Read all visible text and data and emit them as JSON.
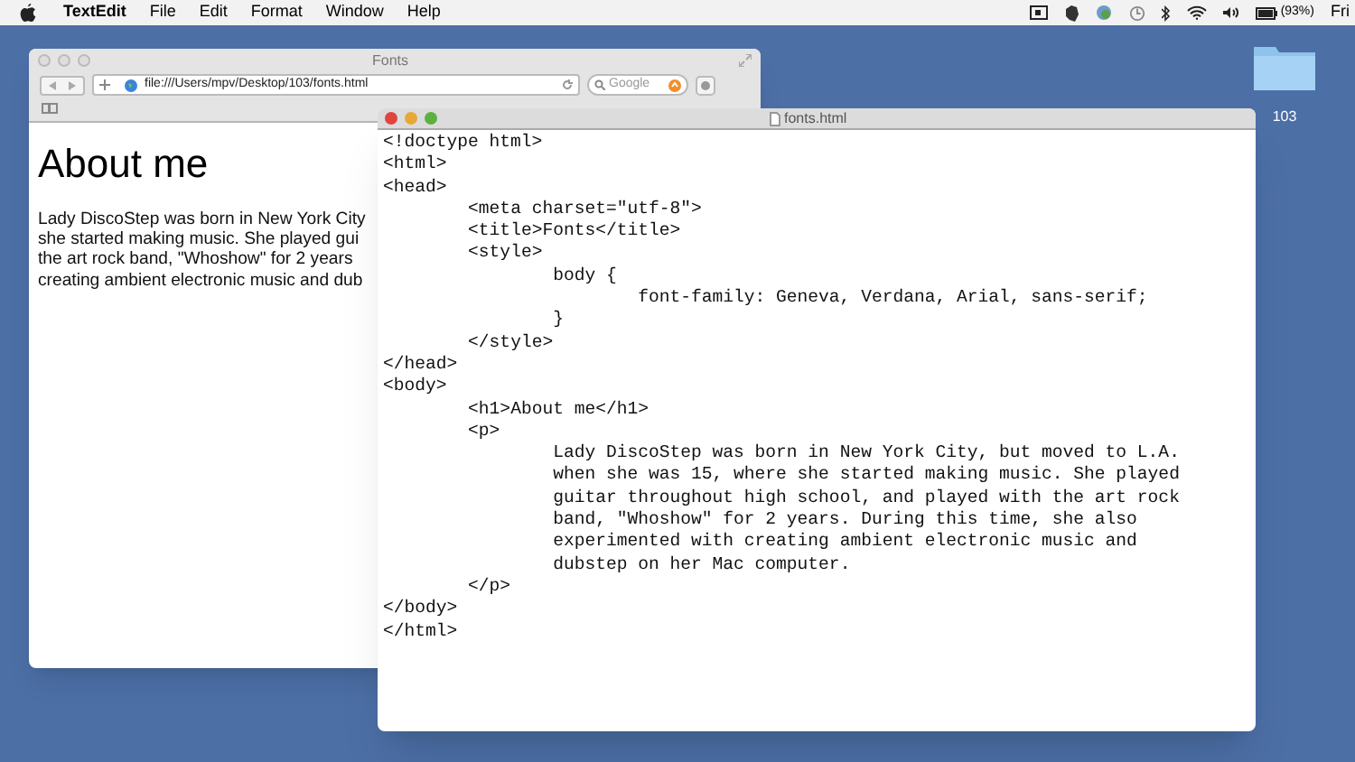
{
  "menu_bar": {
    "app": "TextEdit",
    "items": [
      "File",
      "Edit",
      "Format",
      "Window",
      "Help"
    ],
    "battery": "(93%)",
    "day": "Fri"
  },
  "desktop": {
    "folder_label": "103"
  },
  "browser": {
    "title": "Fonts",
    "address": "file:///Users/mpv/Desktop/103/fonts.html",
    "search_placeholder": "Google",
    "heading": "About me",
    "paragraph_lines": [
      "Lady DiscoStep was born in New York City",
      "she started making music. She played gui",
      "the art rock band, \"Whoshow\" for 2 years",
      "creating ambient electronic music and dub"
    ]
  },
  "editor": {
    "title": "fonts.html",
    "lines": [
      "<!doctype html>",
      "<html>",
      "<head>",
      "\t<meta charset=\"utf-8\">",
      "\t<title>Fonts</title>",
      "\t<style>",
      "\t\tbody {",
      "\t\t\tfont-family: Geneva, Verdana, Arial, sans-serif;",
      "\t\t}",
      "\t</style>",
      "</head>",
      "<body>",
      "\t<h1>About me</h1>",
      "\t<p>",
      "\t\tLady DiscoStep was born in New York City, but moved to L.A.",
      "\t\twhen she was 15, where she started making music. She played",
      "\t\tguitar throughout high school, and played with the art rock",
      "\t\tband, \"Whoshow\" for 2 years. During this time, she also",
      "\t\texperimented with creating ambient electronic music and",
      "\t\tdubstep on her Mac computer.",
      "\t</p>",
      "</body>",
      "</html>"
    ]
  }
}
